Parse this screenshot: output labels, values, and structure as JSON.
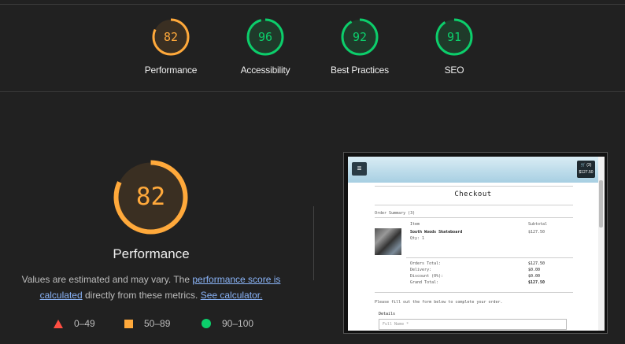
{
  "colors": {
    "pass": "#0cce6b",
    "average": "#ffa93b",
    "fail": "#ff4e42"
  },
  "categories": [
    {
      "label": "Performance",
      "score": 82,
      "color": "#ffa93b"
    },
    {
      "label": "Accessibility",
      "score": 96,
      "color": "#0cce6b"
    },
    {
      "label": "Best Practices",
      "score": 92,
      "color": "#0cce6b"
    },
    {
      "label": "SEO",
      "score": 91,
      "color": "#0cce6b"
    }
  ],
  "performance": {
    "score": 82,
    "title": "Performance",
    "desc_prefix": "Values are estimated and may vary. The ",
    "link_score": "performance score is calculated",
    "desc_mid": " directly from these metrics. ",
    "link_calc": "See calculator."
  },
  "legend": [
    {
      "shape": "triangle",
      "range": "0–49"
    },
    {
      "shape": "square",
      "range": "50–89"
    },
    {
      "shape": "circle",
      "range": "90–100"
    }
  ],
  "thumbnail": {
    "menu_icon": "hamburger-icon",
    "cart_count": "(3)",
    "cart_total": "$127.50",
    "heading": "Checkout",
    "order_summary": "Order Summary (3)",
    "col_item": "Item",
    "col_subtotal": "Subtotal",
    "product_name": "South Woods Skateboard",
    "product_qty": "Qty: 1",
    "product_price": "$127.50",
    "orders_total_label": "Orders Total:",
    "orders_total": "$127.50",
    "delivery_label": "Delivery:",
    "delivery": "$0.00",
    "discount_label": "Discount (0%):",
    "discount": "$0.00",
    "grand_total_label": "Grand Total:",
    "grand_total": "$127.50",
    "form_hint": "Please fill out the form below to complete your order.",
    "details_label": "Details",
    "name_placeholder": "Full Name *"
  }
}
